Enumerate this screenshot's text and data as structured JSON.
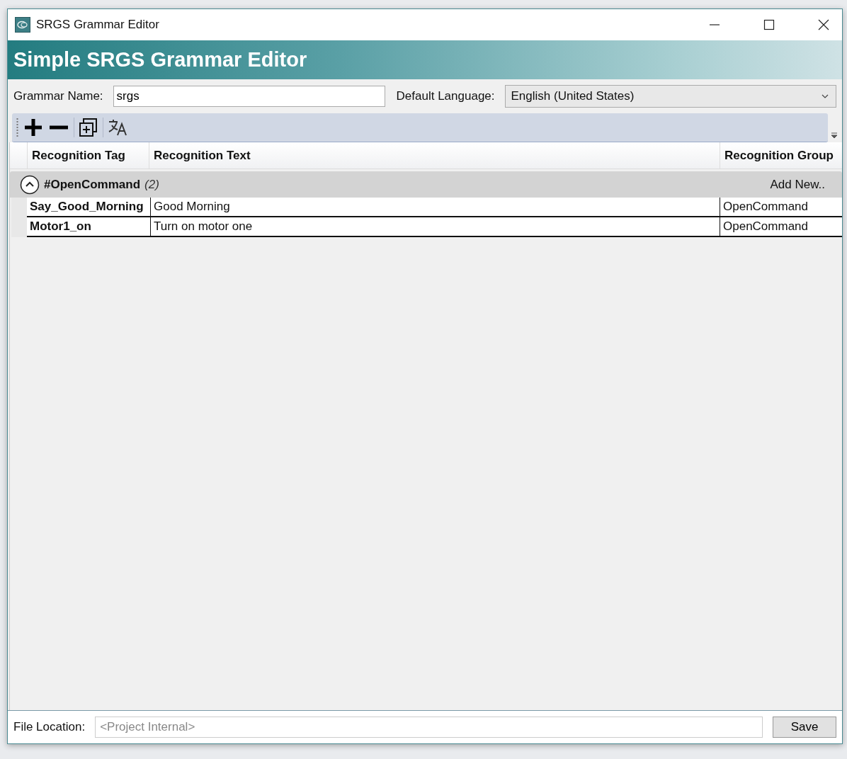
{
  "window": {
    "title": "SRGS Grammar Editor"
  },
  "banner": {
    "title": "Simple SRGS Grammar Editor"
  },
  "form": {
    "grammar_name_label": "Grammar Name:",
    "grammar_name": "srgs",
    "language_label": "Default Language:",
    "language": "English (United States)"
  },
  "table": {
    "columns": [
      "Recognition Tag",
      "Recognition Text",
      "Recognition Group"
    ],
    "groups": [
      {
        "name": "#OpenCommand",
        "count": "(2)",
        "expanded": true,
        "add_label": "Add New..",
        "rows": [
          {
            "tag": "Say_Good_Morning",
            "text": "Good Morning",
            "group": "OpenCommand"
          },
          {
            "tag": "Motor1_on",
            "text": "Turn on motor one",
            "group": "OpenCommand"
          }
        ]
      }
    ]
  },
  "footer": {
    "file_label": "File Location:",
    "file_placeholder": "<Project Internal>",
    "save": "Save"
  }
}
